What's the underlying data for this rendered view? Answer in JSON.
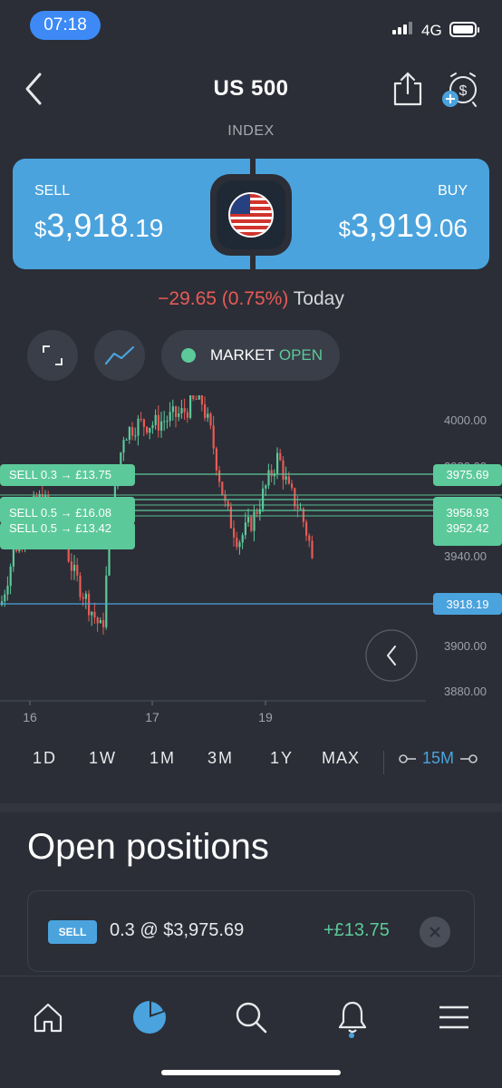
{
  "status_bar": {
    "time": "07:18",
    "network": "4G"
  },
  "header": {
    "title": "US 500",
    "subtitle": "INDEX"
  },
  "quote": {
    "sell_label": "SELL",
    "sell_currency": "$",
    "sell_main": "3,918",
    "sell_decimal": ".19",
    "buy_label": "BUY",
    "buy_currency": "$",
    "buy_main": "3,919",
    "buy_decimal": ".06",
    "change": "−29.65 (0.75%)",
    "change_period": "Today"
  },
  "market": {
    "label": "MARKET",
    "status": "OPEN"
  },
  "chart_data": {
    "type": "candlestick",
    "y_ticks": [
      "4000.00",
      "3980.00",
      "3960.00",
      "3940.00",
      "3900.00",
      "3880.00"
    ],
    "x_ticks": [
      "16",
      "17",
      "19"
    ],
    "ylim": [
      3880,
      4000
    ],
    "orders": [
      {
        "label": "SELL 0.3",
        "arrow": "→",
        "amount": "£13.75",
        "price": "3975.69"
      },
      {
        "label": "SELL 0.5",
        "arrow": "→",
        "amount": "£16.08",
        "price": "3958.93"
      },
      {
        "label": "SELL 0.5",
        "arrow": "→",
        "amount": "£13.42",
        "price": "3952.42"
      }
    ],
    "current_price": "3918.19",
    "colors": {
      "up": "#5cc99a",
      "down": "#e85a57",
      "order_line": "#5cc99a",
      "current_line": "#4aa3dd"
    }
  },
  "timeframes": [
    "1D",
    "1W",
    "1M",
    "3M",
    "1Y",
    "MAX"
  ],
  "interval": "15M",
  "positions": {
    "title": "Open positions",
    "items": [
      {
        "side": "SELL",
        "desc": "0.3 @ $3,975.69",
        "pnl": "+£13.75"
      }
    ]
  },
  "colors": {
    "accent": "#4aa3dd",
    "positive": "#5cc99a",
    "negative": "#e85a57",
    "background": "#2b2e36"
  }
}
